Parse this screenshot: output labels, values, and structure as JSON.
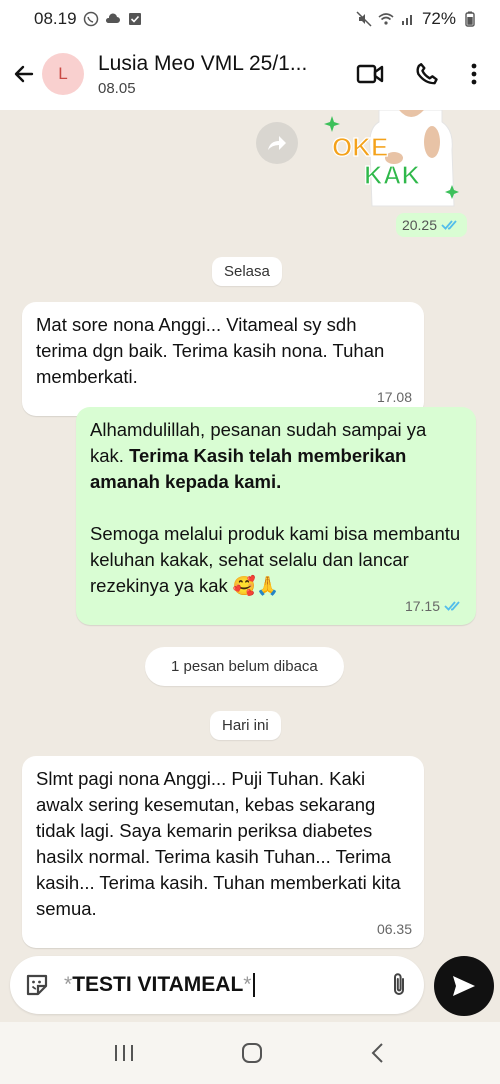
{
  "status": {
    "time": "08.19",
    "battery": "72%"
  },
  "header": {
    "avatar_letter": "L",
    "title": "Lusia Meo VML 25/1...",
    "subtitle": "08.05"
  },
  "sticker": {
    "text_line1": "OKE",
    "text_line2": "KAK",
    "time": "20.25"
  },
  "chips": {
    "day1": "Selasa",
    "unread": "1 pesan belum dibaca",
    "today": "Hari ini"
  },
  "messages": [
    {
      "direction": "in",
      "text": "Mat sore nona Anggi... Vitameal sy sdh terima dgn baik. Terima kasih nona. Tuhan memberkati.",
      "time": "17.08"
    },
    {
      "direction": "out",
      "text_plain1": "Alhamdulillah, pesanan sudah sampai ya kak. ",
      "text_bold": "Terima Kasih telah memberikan amanah kepada kami.",
      "text_plain2": "Semoga melalui produk kami bisa membantu keluhan kakak, sehat selalu dan lancar rezekinya ya kak 🥰🙏",
      "time": "17.15"
    },
    {
      "direction": "in",
      "text": "Slmt pagi nona Anggi... Puji Tuhan. Kaki awalx sering kesemutan, kebas sekarang tidak lagi. Saya kemarin periksa diabetes hasilx normal. Terima kasih Tuhan... Terima kasih... Terima kasih. Tuhan memberkati kita semua.",
      "time": "06.35"
    }
  ],
  "composer": {
    "ast_left": "*",
    "value": "TESTI VITAMEAL",
    "ast_right": "*"
  },
  "icons": [
    "back-arrow-icon",
    "video-call-icon",
    "phone-icon",
    "more-icon",
    "forward-icon",
    "sticker-icon",
    "attach-icon",
    "send-icon",
    "read-ticks-icon",
    "recents-icon",
    "home-icon",
    "back-nav-icon"
  ],
  "colors": {
    "incoming": "#ffffff",
    "outgoing": "#d9fdd3",
    "tick": "#53bdeb",
    "chat_bg": "#efeae2"
  }
}
